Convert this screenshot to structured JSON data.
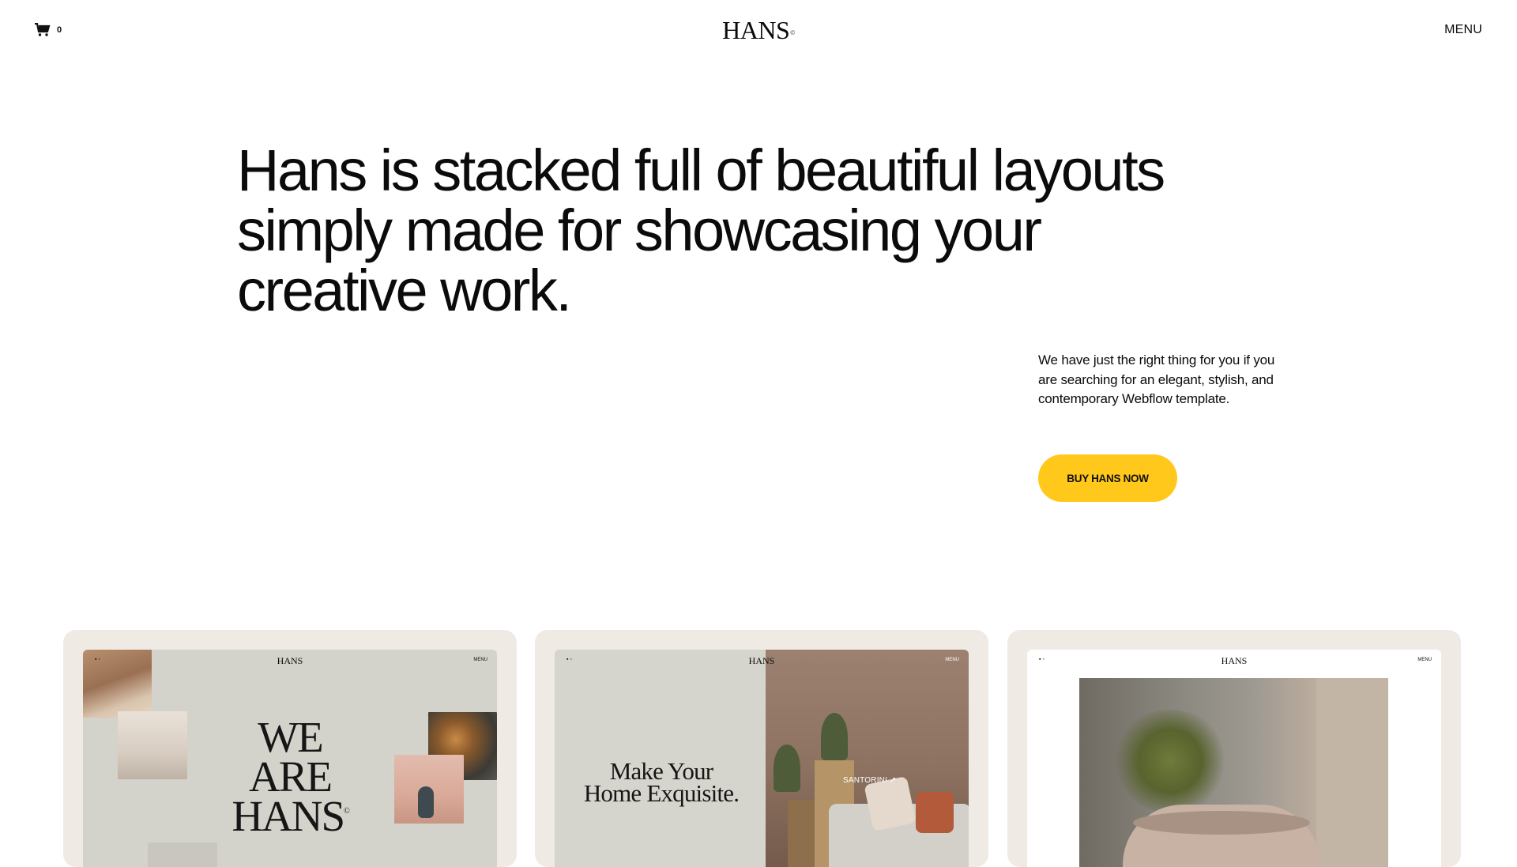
{
  "header": {
    "cart_count": "0",
    "logo": "HANS",
    "logo_mark": "©",
    "menu_label": "MENU"
  },
  "hero": {
    "title": "Hans is stacked full of beautiful layouts simply made for showcasing your creative work.",
    "description": "We have just the right thing for you if you are searching for an elegant, stylish, and contemporary Webflow template.",
    "button_label": "BUY HANS NOW",
    "button_color": "#ffc81b"
  },
  "cards": [
    {
      "mini_logo": "HANS",
      "mini_menu": "MENU",
      "headline_lines": [
        "WE",
        "ARE",
        "HANS"
      ],
      "headline_mark": "©"
    },
    {
      "mini_logo": "HANS",
      "mini_menu": "MENU",
      "headline_lines": [
        "Make Your",
        "Home Exquisite."
      ],
      "tag": "SANTORINI ↗"
    },
    {
      "mini_logo": "HANS",
      "mini_menu": "MENU"
    }
  ],
  "colors": {
    "card_background": "#efebe4",
    "text": "#0b0b0b",
    "accent": "#ffc81b"
  },
  "icons": {
    "cart": "shopping-cart-icon"
  }
}
